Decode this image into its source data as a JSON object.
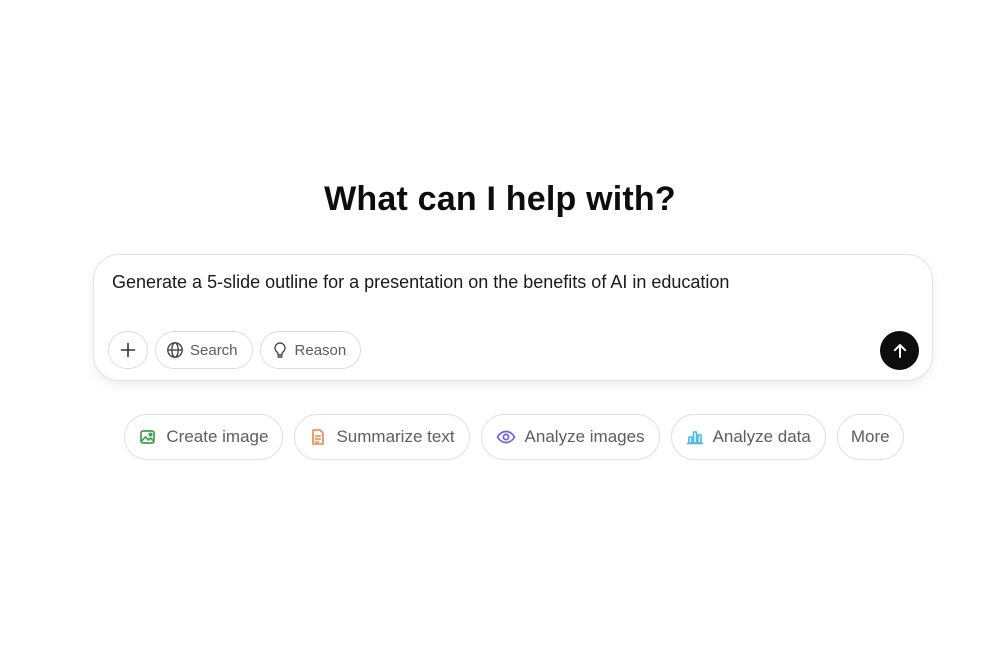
{
  "heading": "What can I help with?",
  "composer": {
    "prompt": "Generate a 5-slide outline for a presentation on the benefits of AI in education",
    "tools": {
      "add_icon": "plus-icon",
      "search_label": "Search",
      "search_icon": "globe-icon",
      "reason_label": "Reason",
      "reason_icon": "lightbulb-icon"
    },
    "send_icon": "arrow-up-icon"
  },
  "suggestions": [
    {
      "label": "Create image",
      "icon": "image-icon",
      "color": "#3fa34d"
    },
    {
      "label": "Summarize text",
      "icon": "document-icon",
      "color": "#e8884a"
    },
    {
      "label": "Analyze images",
      "icon": "eye-icon",
      "color": "#6e62e5"
    },
    {
      "label": "Analyze data",
      "icon": "bar-chart-icon",
      "color": "#4bb7e8"
    },
    {
      "label": "More",
      "icon": "",
      "color": ""
    }
  ]
}
